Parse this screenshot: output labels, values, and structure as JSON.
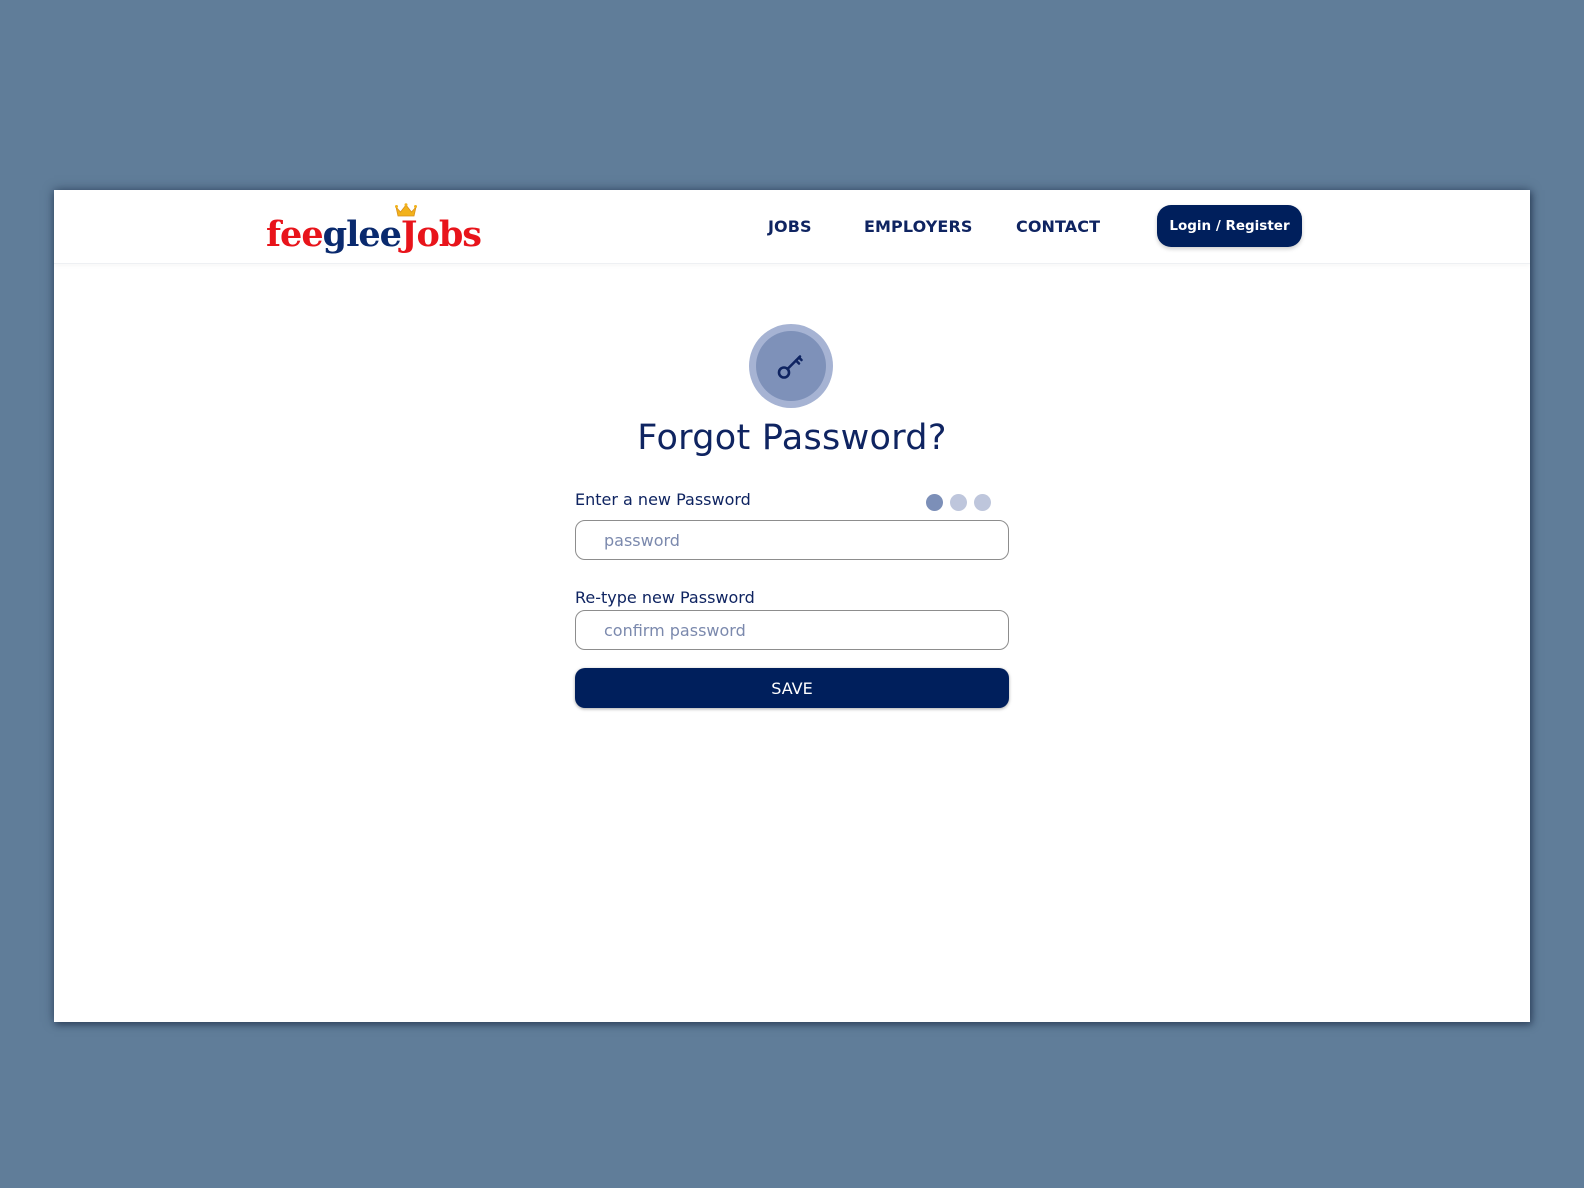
{
  "brand": {
    "logo_parts": [
      "fee",
      "glee",
      "J",
      "obs"
    ],
    "logo_text": "feegleeJobs",
    "colors": {
      "red": "#e8141b",
      "navy": "#0a2a6e",
      "crown": "#f2b21b"
    }
  },
  "nav": {
    "links": [
      {
        "label": "JOBS"
      },
      {
        "label": "EMPLOYERS"
      },
      {
        "label": "CONTACT"
      }
    ],
    "login_label": "Login / Register"
  },
  "page": {
    "icon": "key-icon",
    "title": "Forgot Password?",
    "step_indicator": {
      "total": 3,
      "current": 1
    }
  },
  "form": {
    "new_password": {
      "label": "Enter a new Password",
      "placeholder": "password",
      "value": ""
    },
    "confirm_password": {
      "label": "Re-type new Password",
      "placeholder": "confirm password",
      "value": ""
    },
    "save_label": "SAVE"
  },
  "theme": {
    "primary": "#001f5c",
    "text": "#0f2461",
    "background": "#607d99",
    "badge_outer": "#a6b3d3",
    "badge_inner": "#7e91b9"
  }
}
